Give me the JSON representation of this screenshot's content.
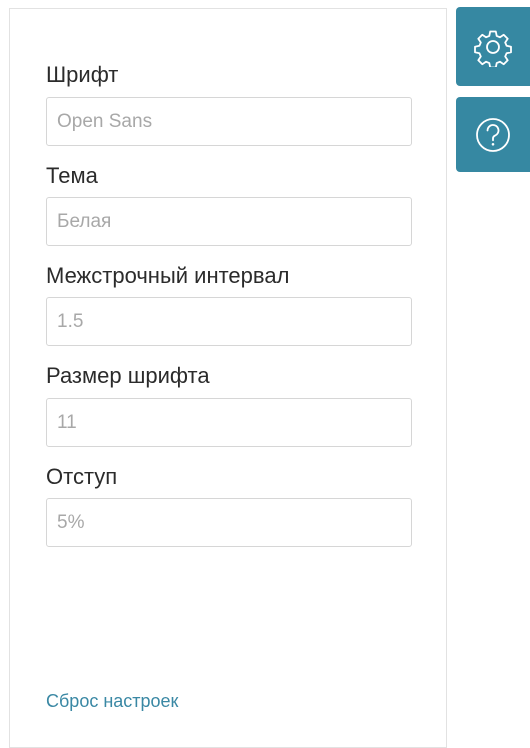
{
  "settings": {
    "fields": [
      {
        "label": "Шрифт",
        "value": "Open Sans"
      },
      {
        "label": "Тема",
        "value": "Белая"
      },
      {
        "label": "Межстрочный интервал",
        "value": "1.5"
      },
      {
        "label": "Размер шрифта",
        "value": "11"
      },
      {
        "label": "Отступ",
        "value": "5%"
      }
    ],
    "reset_label": "Сброс настроек"
  },
  "sidebar": {
    "buttons": [
      {
        "icon": "gear-icon"
      },
      {
        "icon": "help-icon"
      }
    ]
  },
  "colors": {
    "accent": "#3688a2",
    "link": "#3a88a4",
    "label": "#2b2b2b",
    "input_text": "#a8a8a8",
    "border": "#d6d6d6"
  }
}
